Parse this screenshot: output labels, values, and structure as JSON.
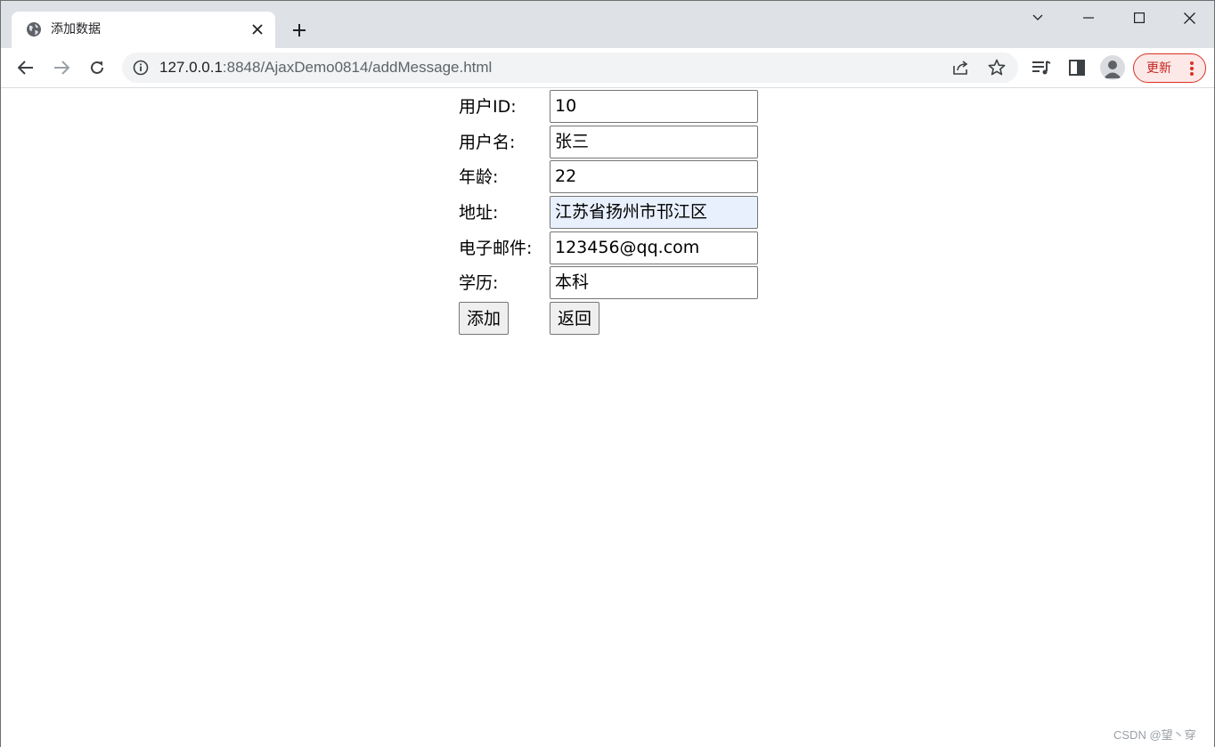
{
  "browser": {
    "tab": {
      "title": "添加数据",
      "favicon": "globe-icon"
    },
    "new_tab": "plus-icon",
    "window_controls": [
      "chevron-down-icon",
      "minimize-icon",
      "maximize-icon",
      "close-icon"
    ],
    "nav": [
      "back-arrow-icon",
      "forward-arrow-icon",
      "reload-icon"
    ],
    "address": {
      "host": "127.0.0.1",
      "rest": ":8848/AjaxDemo0814/addMessage.html"
    },
    "toolbar_icons": [
      "share-icon",
      "star-icon",
      "reading-list-icon",
      "side-panel-icon",
      "profile-icon",
      "more-vertical-icon"
    ],
    "update_label": "更新"
  },
  "form": {
    "fields": [
      {
        "label": "用户ID:",
        "value": "10"
      },
      {
        "label": "用户名:",
        "value": "张三"
      },
      {
        "label": "年龄:",
        "value": "22"
      },
      {
        "label": "地址:",
        "value": "江苏省扬州市邗江区"
      },
      {
        "label": "电子邮件:",
        "value": "123456@qq.com"
      },
      {
        "label": "学历:",
        "value": "本科"
      }
    ],
    "add_button": "添加",
    "back_button": "返回"
  },
  "watermark": "CSDN @望丶穿",
  "colors": {
    "tab_strip": "#dee1e6",
    "autofill": "#e8f0fe",
    "update_border": "#d93025"
  }
}
